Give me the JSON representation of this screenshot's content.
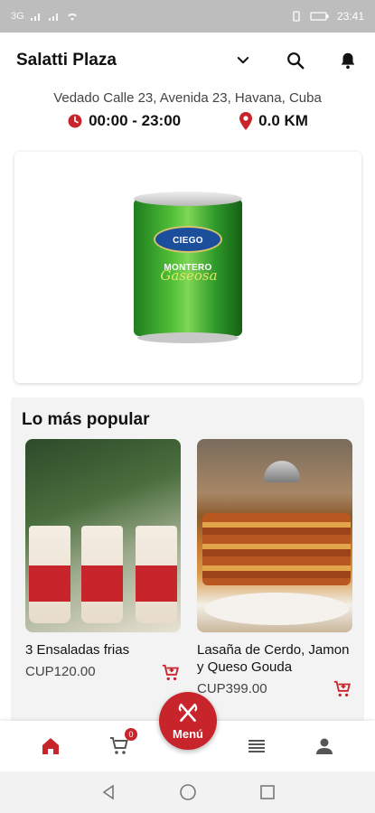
{
  "status_bar": {
    "time": "23:41",
    "left_text": "3G",
    "right_text": ""
  },
  "header": {
    "store_name": "Salatti Plaza",
    "dropdown_icon": "chevron-down-icon",
    "search_icon": "search-icon",
    "bell_icon": "bell-icon"
  },
  "store_info": {
    "address": "Vedado Calle 23, Avenida 23, Havana, Cuba",
    "hours": "00:00 - 23:00",
    "distance": "0.0 KM"
  },
  "banner": {
    "can_brand": "CIEGO MONTERO",
    "can_script": "Gaseosa"
  },
  "popular": {
    "title": "Lo más popular",
    "products": [
      {
        "name": "3 Ensaladas frias",
        "price": "CUP120.00"
      },
      {
        "name": "Lasaña de Cerdo, Jamon y Queso Gouda",
        "price": "CUP399.00"
      }
    ]
  },
  "bottom_nav": {
    "fab_label": "Menú",
    "cart_count": "0"
  },
  "colors": {
    "accent": "#c8242c",
    "text": "#111111",
    "muted": "#444444"
  }
}
